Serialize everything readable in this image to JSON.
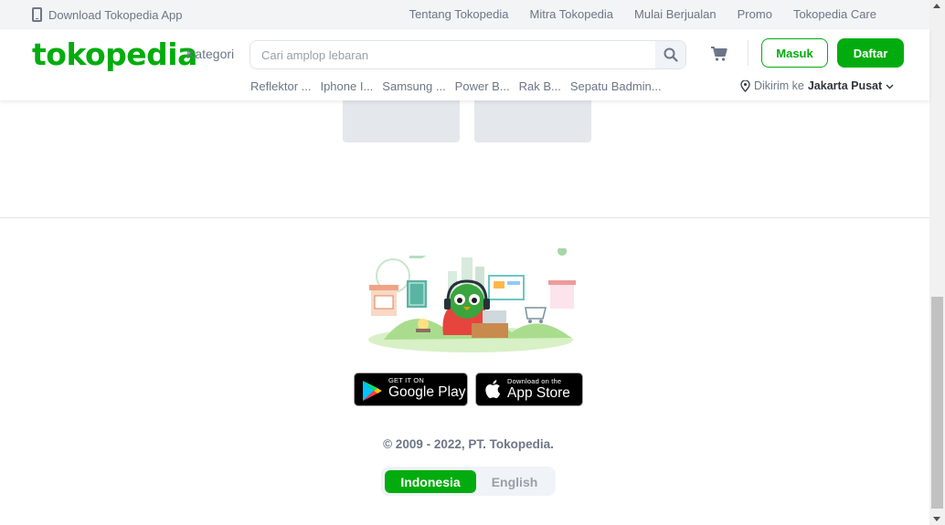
{
  "topbar": {
    "download_app": "Download Tokopedia App",
    "links": [
      "Tentang Tokopedia",
      "Mitra Tokopedia",
      "Mulai Berjualan",
      "Promo",
      "Tokopedia Care"
    ]
  },
  "header": {
    "logo": "tokopedia",
    "kategori": "Kategori",
    "search_placeholder": "Cari amplop lebaran",
    "login": "Masuk",
    "register": "Daftar",
    "suggestions": [
      "Reflektor ...",
      "Iphone I...",
      "Samsung ...",
      "Power B...",
      "Rak B...",
      "Sepatu Badmin..."
    ],
    "shipping_prefix": "Dikirim ke",
    "shipping_location": "Jakarta Pusat"
  },
  "footer": {
    "google_play_small": "GET IT ON",
    "google_play_big": "Google Play",
    "app_store_small": "Download on the",
    "app_store_big": "App Store",
    "copyright": "© 2009 - 2022, PT. Tokopedia.",
    "languages": [
      "Indonesia",
      "English"
    ],
    "active_language": "Indonesia"
  },
  "colors": {
    "brand_green": "#03ac0e",
    "text_muted": "#6d7588",
    "topbar_bg": "#f3f4f5"
  }
}
